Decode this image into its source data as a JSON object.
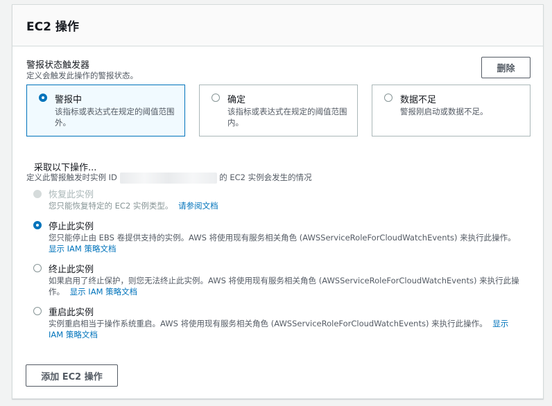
{
  "panel": {
    "title": "EC2 操作",
    "trigger": {
      "label": "警报状态触发器",
      "description": "定义会触发此操作的警报状态。",
      "delete_label": "删除",
      "states": [
        {
          "label": "警报中",
          "description": "该指标或表达式在规定的阈值范围外。",
          "selected": true
        },
        {
          "label": "确定",
          "description": "该指标或表达式在规定的阈值范围内。",
          "selected": false
        },
        {
          "label": "数据不足",
          "description": "警报刚启动或数据不足。",
          "selected": false
        }
      ]
    },
    "action": {
      "label": "采取以下操作...",
      "description_prefix": "定义此警报触发时实例 ID",
      "description_suffix": "的 EC2 实例会发生的情况",
      "options": [
        {
          "label": "恢复此实例",
          "description": "您只能恢复特定的 EC2 实例类型。",
          "link": "请参阅文档",
          "disabled": true,
          "selected": false
        },
        {
          "label": "停止此实例",
          "description": "您只能停止由 EBS 卷提供支持的实例。AWS 将使用现有服务相关角色 (AWSServiceRoleForCloudWatchEvents) 来执行此操作。",
          "link": "显示 IAM 策略文档",
          "disabled": false,
          "selected": true
        },
        {
          "label": "终止此实例",
          "description": "如果启用了终止保护，则您无法终止此实例。AWS 将使用现有服务相关角色 (AWSServiceRoleForCloudWatchEvents) 来执行此操作。",
          "link": "显示 IAM 策略文档",
          "disabled": false,
          "selected": false
        },
        {
          "label": "重启此实例",
          "description": "实例重启相当于操作系统重启。AWS 将使用现有服务相关角色 (AWSServiceRoleForCloudWatchEvents) 来执行此操作。",
          "link": "显示 IAM 策略文档",
          "disabled": false,
          "selected": false
        }
      ]
    },
    "add_button_label": "添加 EC2 操作"
  }
}
